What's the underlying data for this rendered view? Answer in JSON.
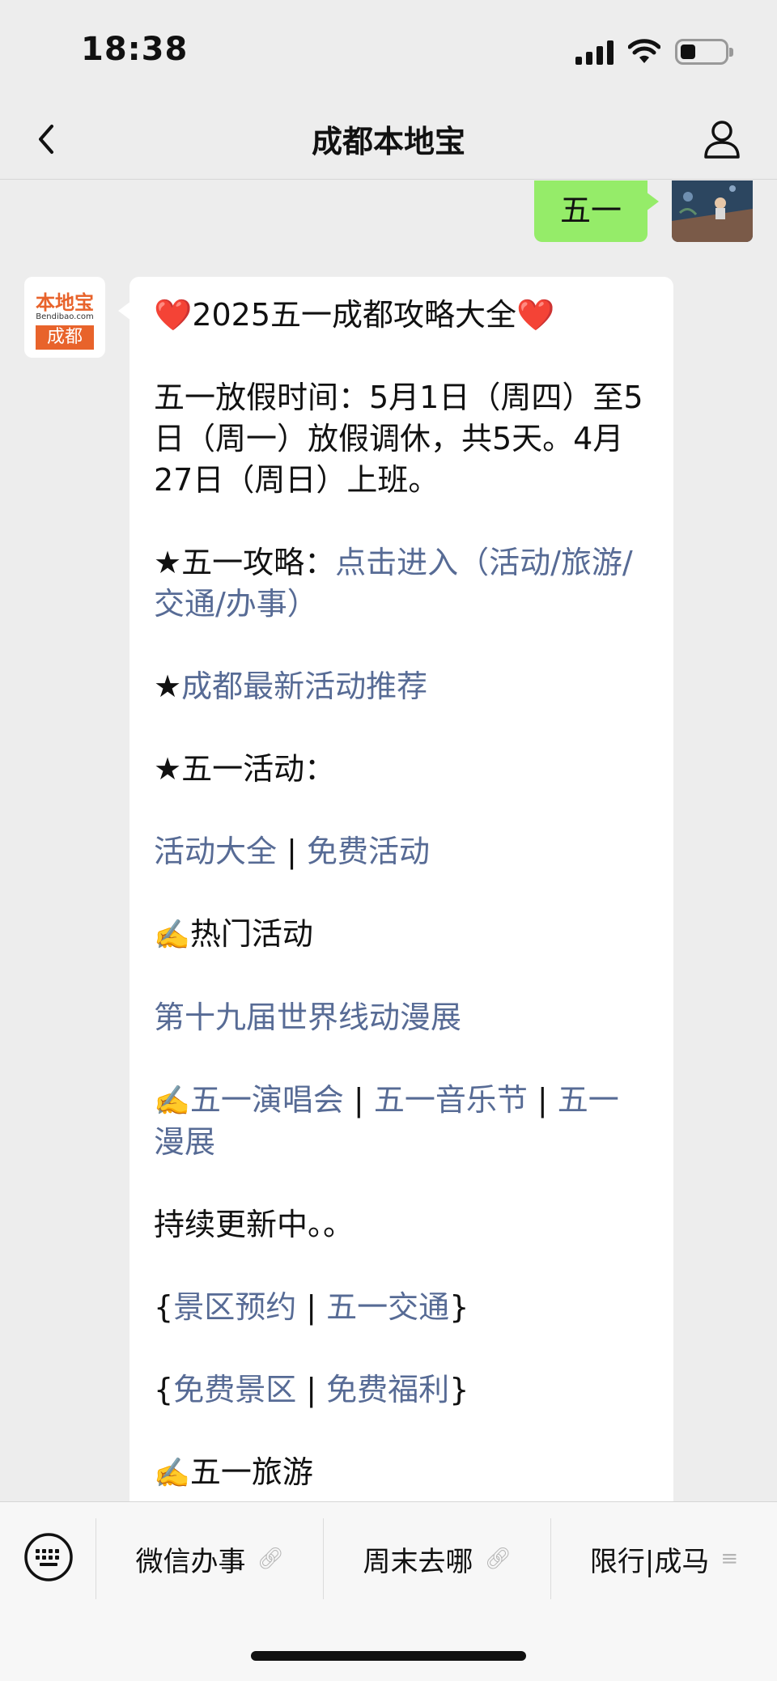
{
  "status_bar": {
    "time": "18:38"
  },
  "nav": {
    "title": "成都本地宝"
  },
  "user_message": {
    "text": "五一"
  },
  "bot_avatar": {
    "top_text": "本地宝",
    "mid_text": "Bendibao.com",
    "bottom_text": "成都"
  },
  "bot_message": {
    "title_heart_left": "❤️",
    "title": "2025五一成都攻略大全",
    "title_heart_right": "❤️",
    "holiday_text": "五一放假时间：5月1日（周四）至5日（周一）放假调休，共5天。4月27日（周日）上班。",
    "guide_prefix": "★五一攻略：",
    "guide_link": "点击进入（活动/旅游/交通/办事）",
    "latest_prefix": "★",
    "latest_link": "成都最新活动推荐",
    "activity_heading": "★五一活动：",
    "activity_link_1": "活动大全",
    "activity_sep": " | ",
    "activity_link_2": "免费活动",
    "hot_emoji": "✍️",
    "hot_heading": "热门活动",
    "hot_link": "第十九届世界线动漫展",
    "concert_emoji": "✍️",
    "concert_link_1": "五一演唱会",
    "concert_sep_1": " | ",
    "concert_link_2": "五一音乐节",
    "concert_sep_2": " | ",
    "concert_link_3": "五一漫展",
    "updating": "持续更新中。。",
    "scenic_open": "{",
    "scenic_link_1": "景区预约",
    "scenic_sep": " | ",
    "scenic_link_2": "五一交通",
    "scenic_close": "}",
    "free_open": "{",
    "free_link_1": "免费景区",
    "free_sep": " | ",
    "free_link_2": "免费福利",
    "free_close": "}",
    "travel_emoji": "✍️",
    "travel_heading": "五一旅游"
  },
  "menu": {
    "items": [
      {
        "label": "微信办事",
        "icon": "link-icon"
      },
      {
        "label": "周末去哪",
        "icon": "link-icon"
      },
      {
        "label": "限行|成马",
        "icon": "menu-icon"
      }
    ]
  },
  "colors": {
    "link": "#576b95",
    "user_bubble": "#95ec69",
    "background": "#ededed"
  }
}
